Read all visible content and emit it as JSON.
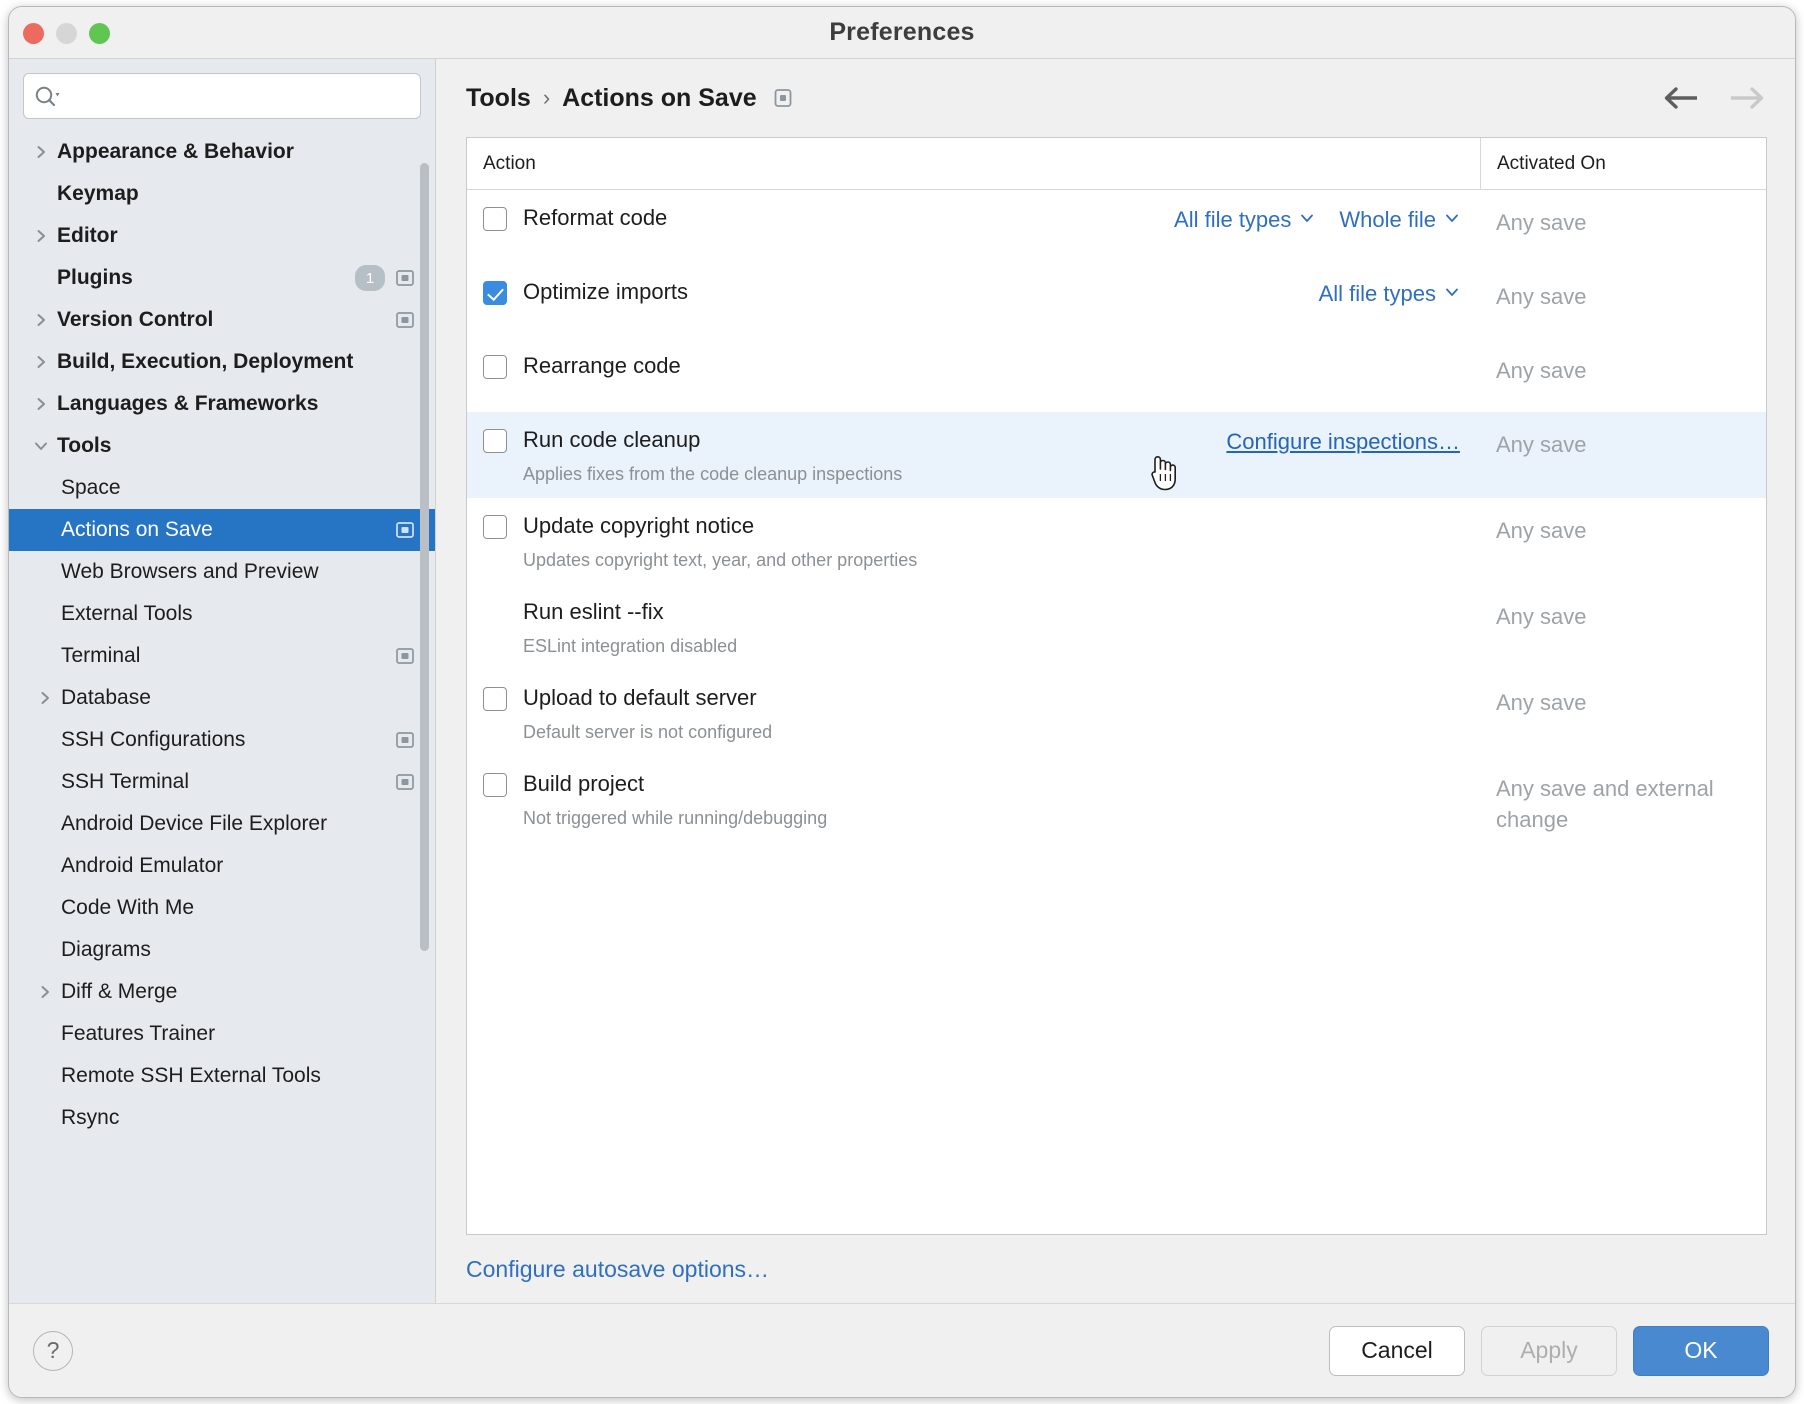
{
  "window": {
    "title": "Preferences",
    "traffic_lights": [
      "close-red",
      "minimize-yellow",
      "zoom-green"
    ]
  },
  "search": {
    "value": "",
    "placeholder": ""
  },
  "sidebar": {
    "items": [
      {
        "label": "Appearance & Behavior",
        "level": "top",
        "twisty": "›",
        "badge": "",
        "sync": false,
        "selected": false
      },
      {
        "label": "Keymap",
        "level": "top",
        "twisty": "",
        "badge": "",
        "sync": false,
        "selected": false
      },
      {
        "label": "Editor",
        "level": "top",
        "twisty": "›",
        "badge": "",
        "sync": false,
        "selected": false
      },
      {
        "label": "Plugins",
        "level": "top",
        "twisty": "",
        "badge": "1",
        "sync": true,
        "selected": false
      },
      {
        "label": "Version Control",
        "level": "top",
        "twisty": "›",
        "badge": "",
        "sync": true,
        "selected": false
      },
      {
        "label": "Build, Execution, Deployment",
        "level": "top",
        "twisty": "›",
        "badge": "",
        "sync": false,
        "selected": false
      },
      {
        "label": "Languages & Frameworks",
        "level": "top",
        "twisty": "›",
        "badge": "",
        "sync": false,
        "selected": false
      },
      {
        "label": "Tools",
        "level": "top",
        "twisty": "⌄",
        "badge": "",
        "sync": false,
        "selected": false
      },
      {
        "label": "Space",
        "level": "sub",
        "twisty": "",
        "badge": "",
        "sync": false,
        "selected": false
      },
      {
        "label": "Actions on Save",
        "level": "sub",
        "twisty": "",
        "badge": "",
        "sync": true,
        "selected": true
      },
      {
        "label": "Web Browsers and Preview",
        "level": "sub",
        "twisty": "",
        "badge": "",
        "sync": false,
        "selected": false
      },
      {
        "label": "External Tools",
        "level": "sub",
        "twisty": "",
        "badge": "",
        "sync": false,
        "selected": false
      },
      {
        "label": "Terminal",
        "level": "sub",
        "twisty": "",
        "badge": "",
        "sync": true,
        "selected": false
      },
      {
        "label": "Database",
        "level": "sub",
        "twisty": "›",
        "badge": "",
        "sync": false,
        "selected": false
      },
      {
        "label": "SSH Configurations",
        "level": "sub",
        "twisty": "",
        "badge": "",
        "sync": true,
        "selected": false
      },
      {
        "label": "SSH Terminal",
        "level": "sub",
        "twisty": "",
        "badge": "",
        "sync": true,
        "selected": false
      },
      {
        "label": "Android Device File Explorer",
        "level": "sub",
        "twisty": "",
        "badge": "",
        "sync": false,
        "selected": false
      },
      {
        "label": "Android Emulator",
        "level": "sub",
        "twisty": "",
        "badge": "",
        "sync": false,
        "selected": false
      },
      {
        "label": "Code With Me",
        "level": "sub",
        "twisty": "",
        "badge": "",
        "sync": false,
        "selected": false
      },
      {
        "label": "Diagrams",
        "level": "sub",
        "twisty": "",
        "badge": "",
        "sync": false,
        "selected": false
      },
      {
        "label": "Diff & Merge",
        "level": "sub",
        "twisty": "›",
        "badge": "",
        "sync": false,
        "selected": false
      },
      {
        "label": "Features Trainer",
        "level": "sub",
        "twisty": "",
        "badge": "",
        "sync": false,
        "selected": false
      },
      {
        "label": "Remote SSH External Tools",
        "level": "sub",
        "twisty": "",
        "badge": "",
        "sync": false,
        "selected": false
      },
      {
        "label": "Rsync",
        "level": "sub",
        "twisty": "",
        "badge": "",
        "sync": false,
        "selected": false
      }
    ]
  },
  "breadcrumb": {
    "root": "Tools",
    "separator": "›",
    "current": "Actions on Save"
  },
  "nav": {
    "back": "back-arrow",
    "forward": "forward-arrow",
    "back_enabled": true,
    "forward_enabled": false
  },
  "table": {
    "columns": {
      "action": "Action",
      "activated_on": "Activated On"
    },
    "rows": [
      {
        "title": "Reformat code",
        "desc": "",
        "checkbox": "unchecked",
        "options": [
          {
            "label": "All file types",
            "type": "dropdown"
          },
          {
            "label": "Whole file",
            "type": "dropdown"
          }
        ],
        "activated_on": "Any save",
        "highlighted": false
      },
      {
        "title": "Optimize imports",
        "desc": "",
        "checkbox": "checked",
        "options": [
          {
            "label": "All file types",
            "type": "dropdown"
          }
        ],
        "activated_on": "Any save",
        "highlighted": false
      },
      {
        "title": "Rearrange code",
        "desc": "",
        "checkbox": "unchecked",
        "options": [],
        "activated_on": "Any save",
        "highlighted": false
      },
      {
        "title": "Run code cleanup",
        "desc": "Applies fixes from the code cleanup inspections",
        "checkbox": "unchecked",
        "options": [
          {
            "label": "Configure inspections…",
            "type": "link"
          }
        ],
        "activated_on": "Any save",
        "highlighted": true
      },
      {
        "title": "Update copyright notice",
        "desc": "Updates copyright text, year, and other properties",
        "checkbox": "unchecked",
        "options": [],
        "activated_on": "Any save",
        "highlighted": false
      },
      {
        "title": "Run eslint --fix",
        "desc": "ESLint integration disabled",
        "checkbox": "none",
        "options": [],
        "activated_on": "Any save",
        "highlighted": false
      },
      {
        "title": "Upload to default server",
        "desc": "Default server is not configured",
        "checkbox": "unchecked",
        "options": [],
        "activated_on": "Any save",
        "highlighted": false
      },
      {
        "title": "Build project",
        "desc": "Not triggered while running/debugging",
        "checkbox": "unchecked",
        "options": [],
        "activated_on": "Any save and external change",
        "highlighted": false
      }
    ]
  },
  "footer": {
    "autosave_link": "Configure autosave options…",
    "help": "?",
    "cancel": "Cancel",
    "apply": "Apply",
    "ok": "OK"
  },
  "colors": {
    "accent_blue": "#2675c4",
    "link_blue": "#2f6fc0",
    "checkbox_blue": "#3a8ce0",
    "primary_button": "#4889d0",
    "row_highlight": "#eaf2fb",
    "sidebar_bg": "#e6eaee",
    "muted_text": "#9ea3a8"
  }
}
